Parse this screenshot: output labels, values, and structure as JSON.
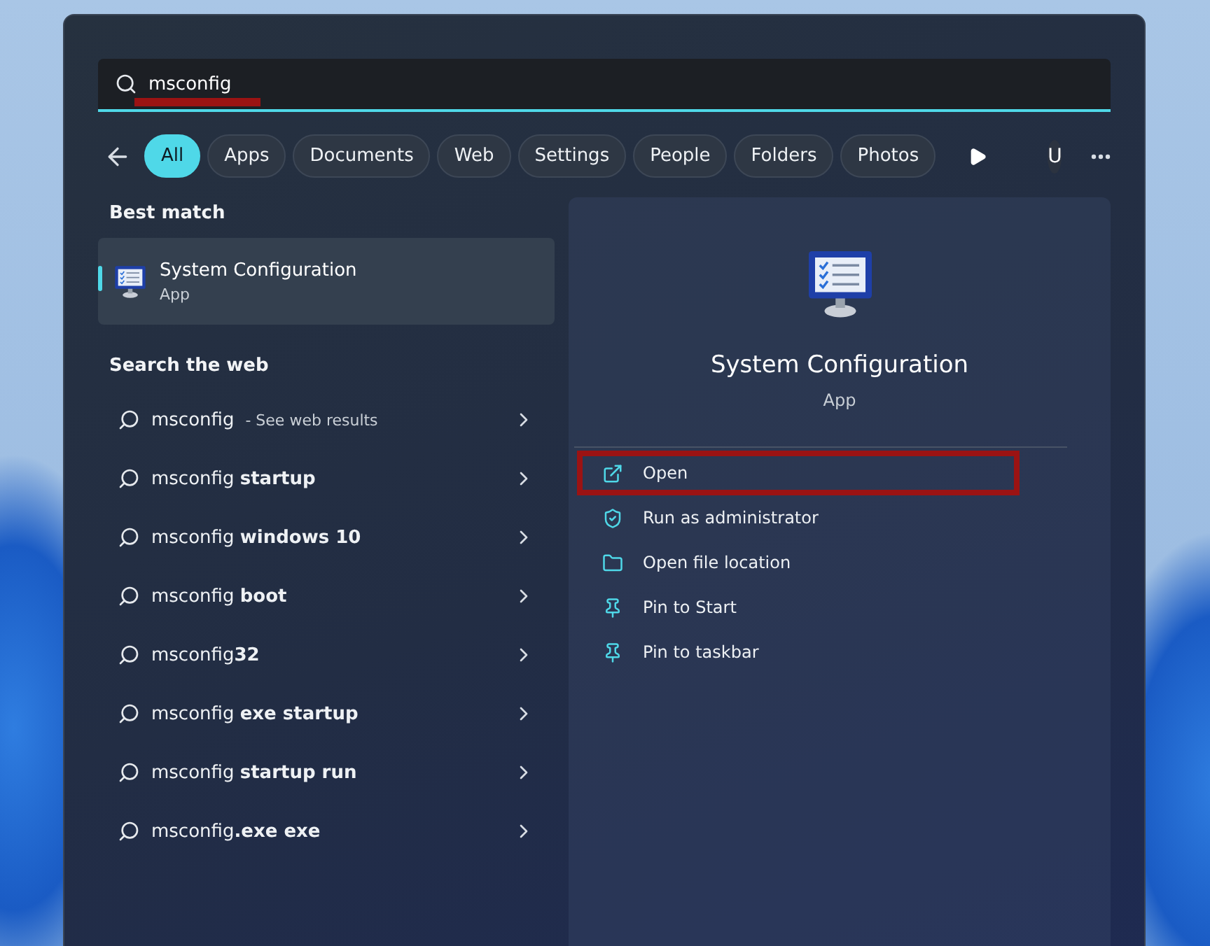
{
  "search": {
    "value": "msconfig",
    "underlined": true
  },
  "filters": [
    {
      "label": "All",
      "selected": true
    },
    {
      "label": "Apps",
      "selected": false
    },
    {
      "label": "Documents",
      "selected": false
    },
    {
      "label": "Web",
      "selected": false
    },
    {
      "label": "Settings",
      "selected": false
    },
    {
      "label": "People",
      "selected": false
    },
    {
      "label": "Folders",
      "selected": false
    },
    {
      "label": "Photos",
      "selected": false
    }
  ],
  "account_initial": "U",
  "best_match": {
    "heading": "Best match",
    "title": "System Configuration",
    "subtitle": "App",
    "selected": true
  },
  "web": {
    "heading": "Search the web",
    "results": [
      {
        "query": "msconfig",
        "hint": "- See web results"
      },
      {
        "query": "msconfig **startup**"
      },
      {
        "query": "msconfig **windows 10**"
      },
      {
        "query": "msconfig **boot**"
      },
      {
        "query": "msconfig**32**"
      },
      {
        "query": "msconfig **exe startup**"
      },
      {
        "query": "msconfig **startup run**"
      },
      {
        "query": "msconfig**.exe exe**"
      }
    ]
  },
  "detail": {
    "title": "System Configuration",
    "subtitle": "App",
    "actions": [
      {
        "kind": "open",
        "label": "Open",
        "highlighted": true
      },
      {
        "kind": "admin",
        "label": "Run as administrator",
        "highlighted": false
      },
      {
        "kind": "folder",
        "label": "Open file location",
        "highlighted": false
      },
      {
        "kind": "pin",
        "label": "Pin to Start",
        "highlighted": false
      },
      {
        "kind": "pin",
        "label": "Pin to taskbar",
        "highlighted": false
      }
    ]
  }
}
